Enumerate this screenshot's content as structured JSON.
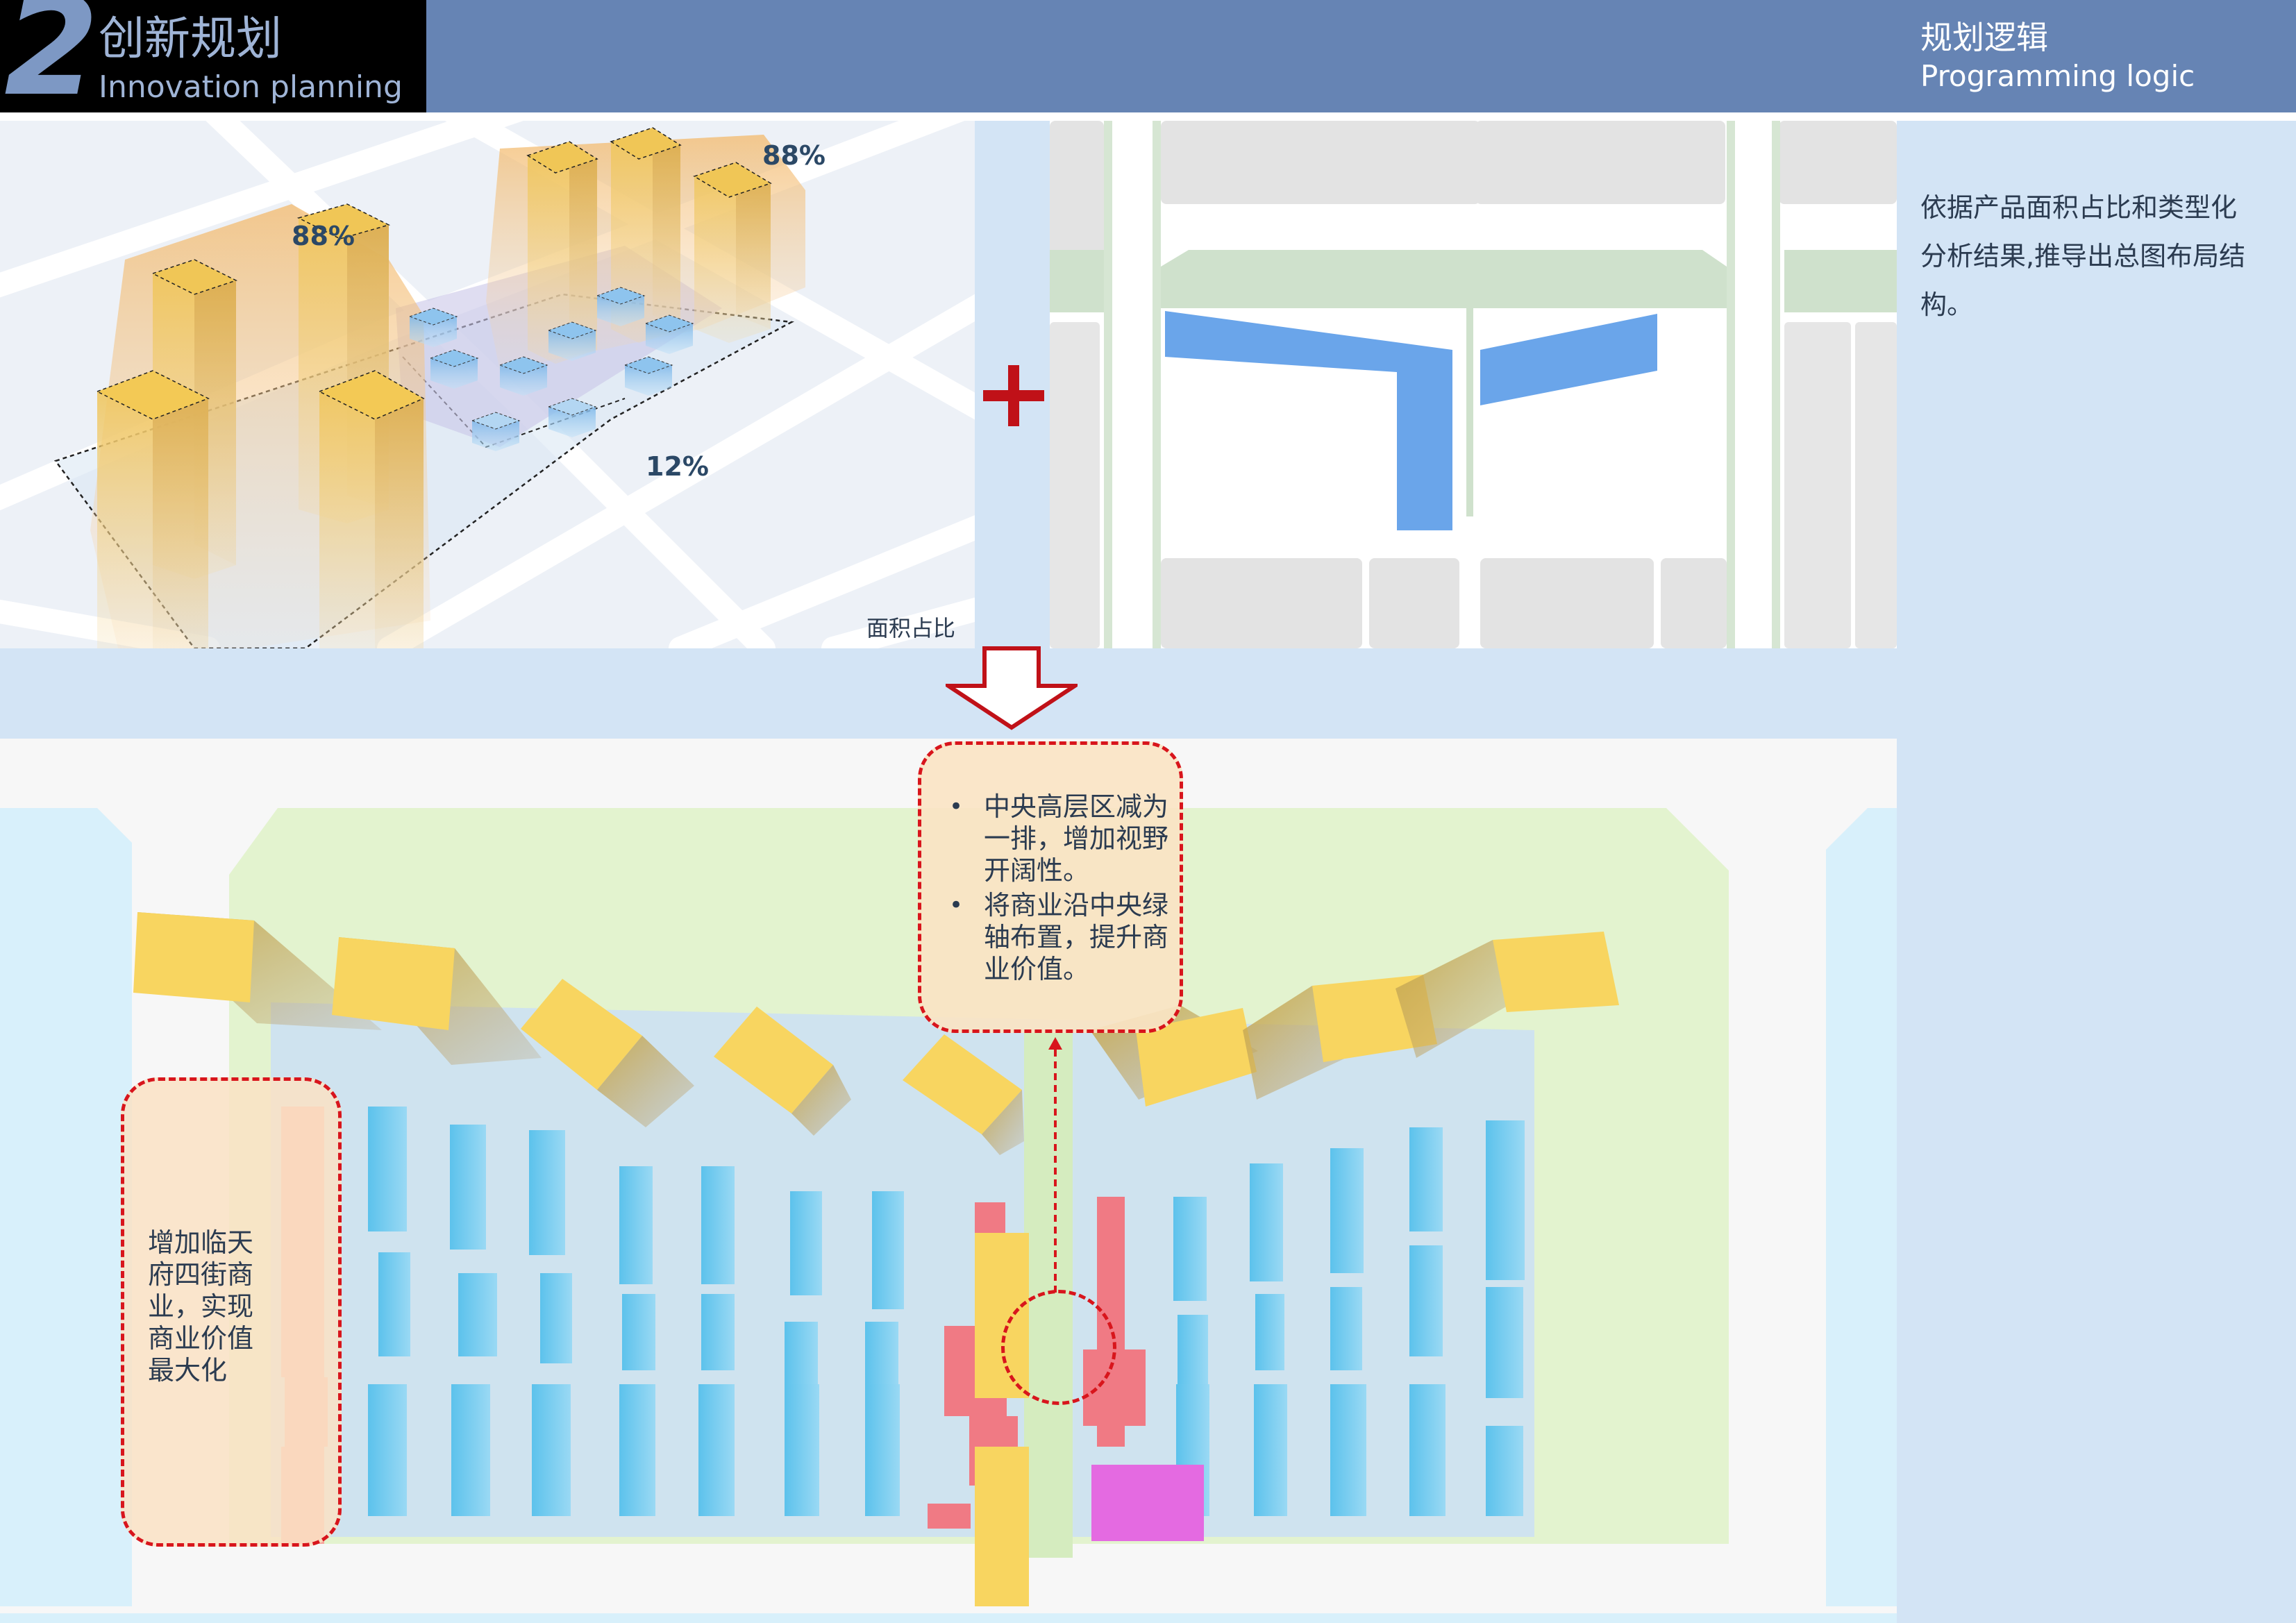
{
  "header": {
    "section_number": "2",
    "title": "创新规划",
    "subtitle": "Innovation planning",
    "right_title": "规划逻辑",
    "right_subtitle": "Programming logic"
  },
  "description": "依据产品面积占比和类型化分析结果,推导出总图布局结构。",
  "area_diagram": {
    "caption": "面积占比",
    "labels": [
      "88%",
      "88%",
      "12%"
    ]
  },
  "callouts": {
    "top": {
      "bullets": [
        "中央高层区减为一排，增加视野开阔性。",
        "将商业沿中央绿轴布置，提升商业价值。"
      ]
    },
    "left": {
      "text": "增加临天府四街商业，实现商业价值最大化"
    }
  },
  "colors": {
    "header_bar": "#6684b4",
    "header_dark": "#000000",
    "background": "#d3e4f5",
    "accent_red": "#d8151c",
    "tower_yellow": "#f7cf5a",
    "low_rise_blue": "#7fd0ef",
    "commercial_red": "#f07a84",
    "map_plot_blue": "#6aa5ea"
  }
}
